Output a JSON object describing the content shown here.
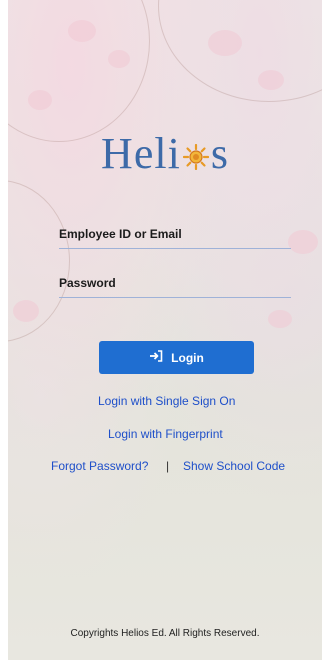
{
  "brand": {
    "logo_text_left": "Heli",
    "logo_text_right": "s",
    "primary_color": "#3d6aa8",
    "sun_color": "#e89a26"
  },
  "login_form": {
    "email_label": "Employee ID or Email",
    "password_label": "Password",
    "login_button_label": "Login",
    "login_button_icon": "login-arrow-icon",
    "button_color": "#1f6ed1",
    "link_color": "#1e4fc9"
  },
  "links": {
    "sso": "Login with Single Sign On",
    "fingerprint": "Login with Fingerprint",
    "forgot_password": "Forgot Password?",
    "separator": "|",
    "school_code": "Show School Code"
  },
  "footer": {
    "text": "Copyrights Helios Ed. All Rights Reserved."
  }
}
